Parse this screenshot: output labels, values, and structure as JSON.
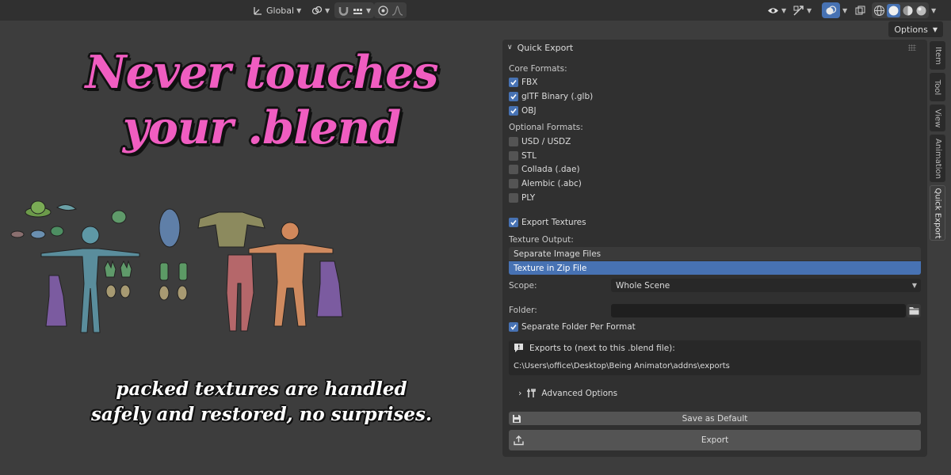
{
  "header": {
    "transform_orientation": "Global",
    "options_label": "Options"
  },
  "promo": {
    "headline_line1": "Never touches",
    "headline_line2": "your .blend",
    "subline_line1": "packed textures are handled",
    "subline_line2": "safely and restored, no surprises."
  },
  "side_tabs": [
    "Item",
    "Tool",
    "View",
    "Animation",
    "Quick Export"
  ],
  "panel": {
    "title": "Quick Export",
    "core_formats_label": "Core Formats:",
    "core_formats": [
      {
        "label": "FBX",
        "checked": true
      },
      {
        "label": "glTF Binary (.glb)",
        "checked": true
      },
      {
        "label": "OBJ",
        "checked": true
      }
    ],
    "optional_formats_label": "Optional Formats:",
    "optional_formats": [
      {
        "label": "USD / USDZ",
        "checked": false
      },
      {
        "label": "STL",
        "checked": false
      },
      {
        "label": "Collada (.dae)",
        "checked": false
      },
      {
        "label": "Alembic (.abc)",
        "checked": false
      },
      {
        "label": "PLY",
        "checked": false
      }
    ],
    "export_textures_label": "Export Textures",
    "texture_output_label": "Texture Output:",
    "texture_output_options": [
      "Separate Image Files",
      "Texture in Zip File"
    ],
    "texture_output_selected": 1,
    "scope_label": "Scope:",
    "scope_value": "Whole Scene",
    "folder_label": "Folder:",
    "folder_value": "",
    "separate_folder_label": "Separate Folder Per Format",
    "exports_to_label": "Exports to (next to this .blend file):",
    "exports_path": "C:\\Users\\office\\Desktop\\Being Animator\\addns\\exports",
    "advanced_label": "Advanced Options",
    "save_default_label": "Save as Default",
    "export_label": "Export"
  },
  "colors": {
    "accent": "#4772b3",
    "headline": "#f05dc1",
    "panel_bg": "#303030",
    "viewport_bg": "#3d3d3d"
  }
}
